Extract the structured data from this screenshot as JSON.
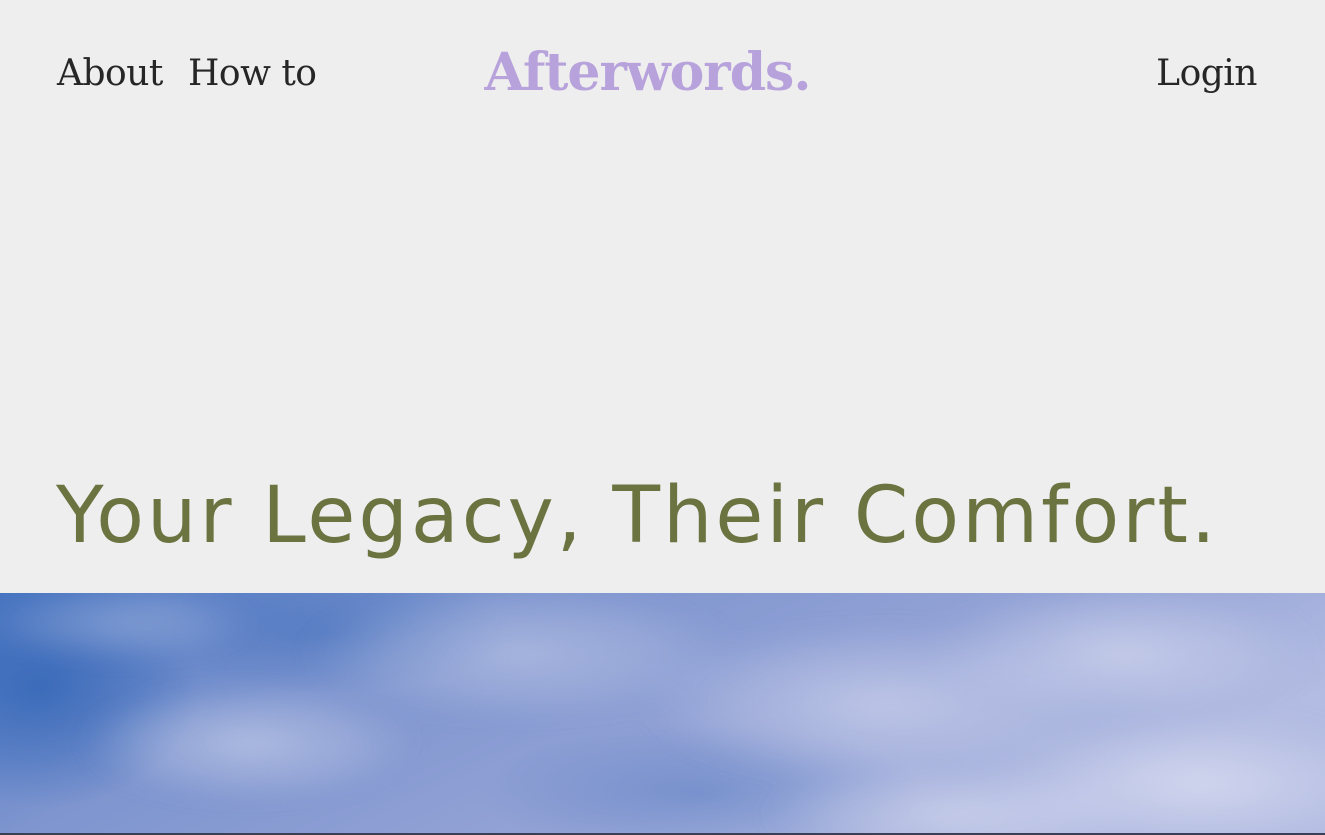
{
  "header": {
    "nav_left": [
      {
        "label": "About"
      },
      {
        "label": "How to"
      }
    ],
    "logo": "Afterwords.",
    "login_label": "Login"
  },
  "hero": {
    "headline": "Your Legacy, Their Comfort.",
    "image": "sky-clouds-image"
  },
  "colors": {
    "background": "#eeeeee",
    "logo": "#b7a2db",
    "nav_text": "#262626",
    "headline": "#6b7340",
    "sky_deep": "#4f78c0",
    "sky_light": "#a9b3dc"
  }
}
